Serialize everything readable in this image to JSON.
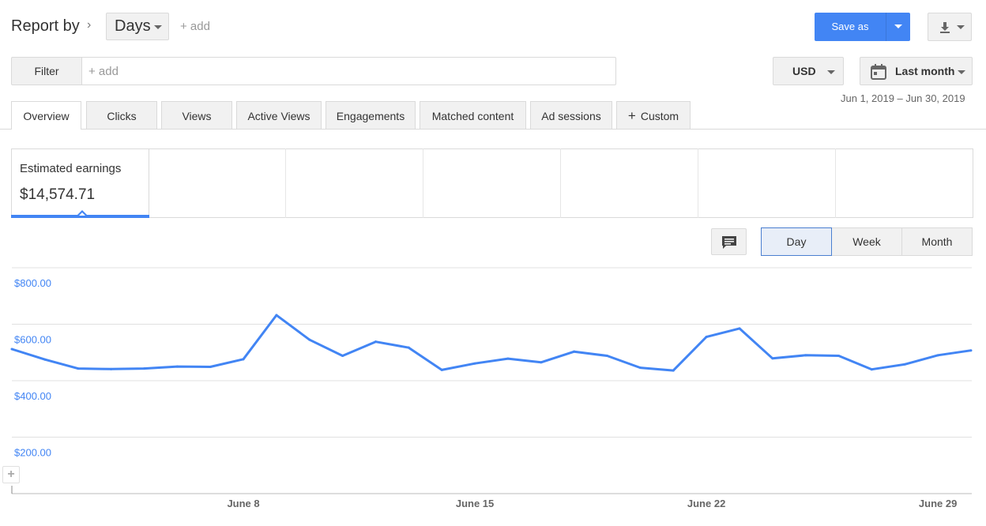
{
  "header": {
    "report_by_label": "Report by",
    "breadcrumb_separator": "›",
    "dimension": "Days",
    "add_link": "+ add",
    "save_as_label": "Save as",
    "download_icon": "download-icon"
  },
  "filter": {
    "label": "Filter",
    "placeholder": "+ add"
  },
  "currency": "USD",
  "date": {
    "label": "Last month",
    "range": "Jun 1, 2019 – Jun 30, 2019",
    "icon": "calendar-icon"
  },
  "tabs": [
    {
      "label": "Overview",
      "active": true
    },
    {
      "label": "Clicks",
      "active": false
    },
    {
      "label": "Views",
      "active": false
    },
    {
      "label": "Active Views",
      "active": false
    },
    {
      "label": "Engagements",
      "active": false
    },
    {
      "label": "Matched content",
      "active": false
    },
    {
      "label": "Ad sessions",
      "active": false
    },
    {
      "label": "Custom",
      "active": false
    }
  ],
  "scorecard": {
    "title": "Estimated earnings",
    "value": "$14,574.71"
  },
  "granularity": {
    "options": [
      "Day",
      "Week",
      "Month"
    ],
    "selected": "Day"
  },
  "colors": {
    "accent": "#4285f4",
    "button_bg": "#f1f1f1",
    "border": "#dadada"
  },
  "chart_data": {
    "type": "line",
    "series": [
      {
        "values": [
          512,
          475,
          443,
          441,
          443,
          450,
          449,
          476,
          632,
          545,
          488,
          538,
          517,
          438,
          461,
          478,
          465,
          503,
          488,
          446,
          436,
          555,
          585,
          479,
          490,
          488,
          440,
          458,
          490,
          507
        ]
      }
    ],
    "x": [
      "June 1",
      "June 2",
      "June 3",
      "June 4",
      "June 5",
      "June 6",
      "June 7",
      "June 8",
      "June 9",
      "June 10",
      "June 11",
      "June 12",
      "June 13",
      "June 14",
      "June 15",
      "June 16",
      "June 17",
      "June 18",
      "June 19",
      "June 20",
      "June 21",
      "June 22",
      "June 23",
      "June 24",
      "June 25",
      "June 26",
      "June 27",
      "June 28",
      "June 29",
      "June 30"
    ],
    "x_tick_labels": [
      "June 8",
      "June 15",
      "June 22",
      "June 29"
    ],
    "y_tick_labels": [
      "$800.00",
      "$600.00",
      "$400.00",
      "$200.00"
    ],
    "y_ticks": [
      800,
      600,
      400,
      200
    ],
    "ylim": [
      0,
      800
    ],
    "grid": true,
    "color": "#4285f4"
  }
}
